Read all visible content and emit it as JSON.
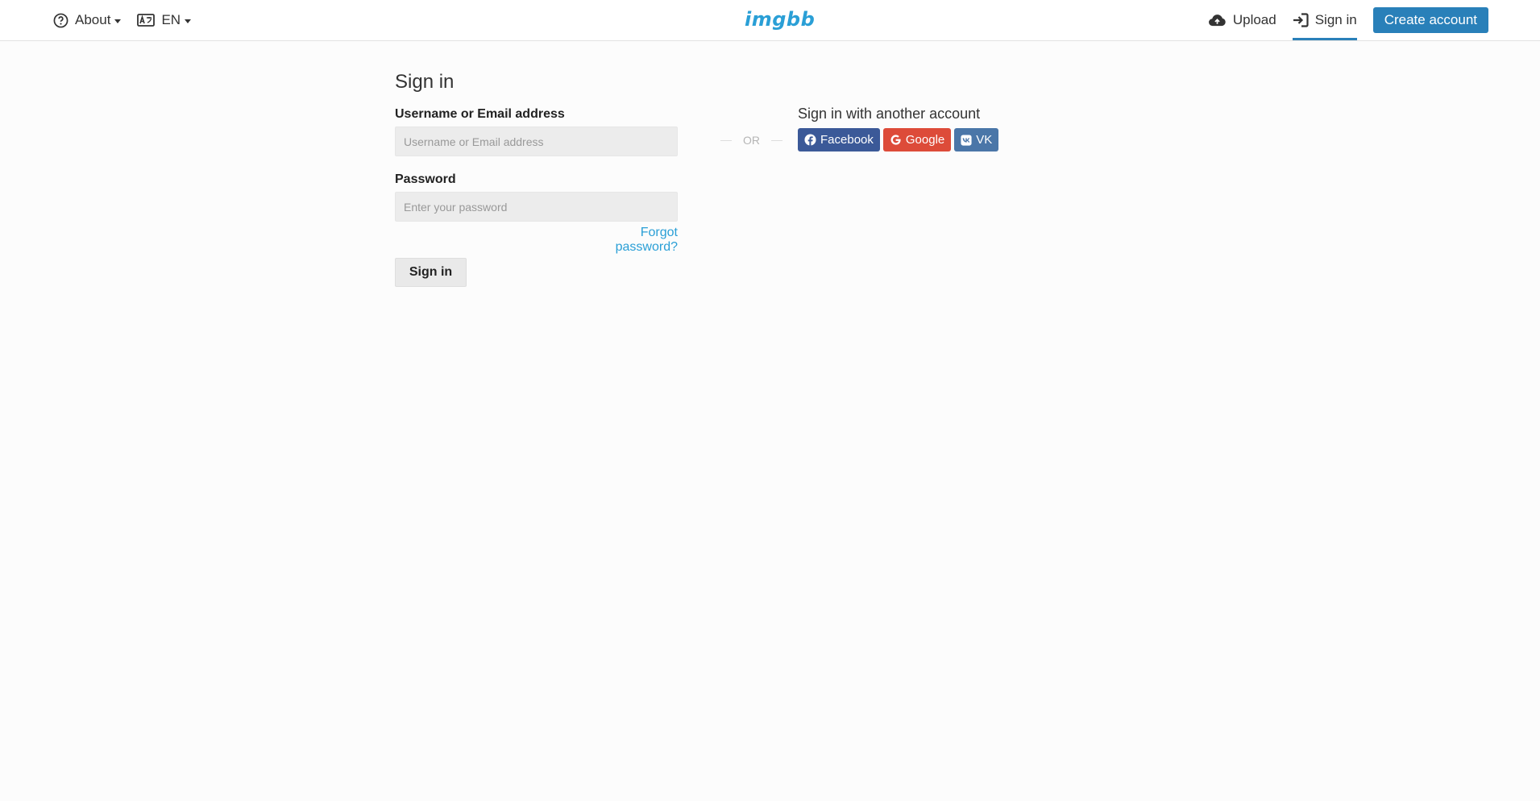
{
  "header": {
    "about_label": "About",
    "language_label": "EN",
    "logo_text": "imgbb",
    "upload_label": "Upload",
    "signin_label": "Sign in",
    "create_account_label": "Create account"
  },
  "form": {
    "title": "Sign in",
    "username_label": "Username or Email address",
    "username_placeholder": "Username or Email address",
    "password_label": "Password",
    "password_placeholder": "Enter your password",
    "forgot_label": "Forgot password?",
    "submit_label": "Sign in"
  },
  "separator": {
    "text": "OR"
  },
  "alt_signin": {
    "title": "Sign in with another account",
    "providers": [
      {
        "label": "Facebook",
        "icon": "facebook-icon",
        "color": "#3b5998"
      },
      {
        "label": "Google",
        "icon": "google-icon",
        "color": "#dd4b39"
      },
      {
        "label": "VK",
        "icon": "vk-icon",
        "color": "#4a76a8"
      }
    ]
  },
  "colors": {
    "accent": "#2980b9",
    "link": "#2a9fd6",
    "background": "#fcfcfc"
  }
}
